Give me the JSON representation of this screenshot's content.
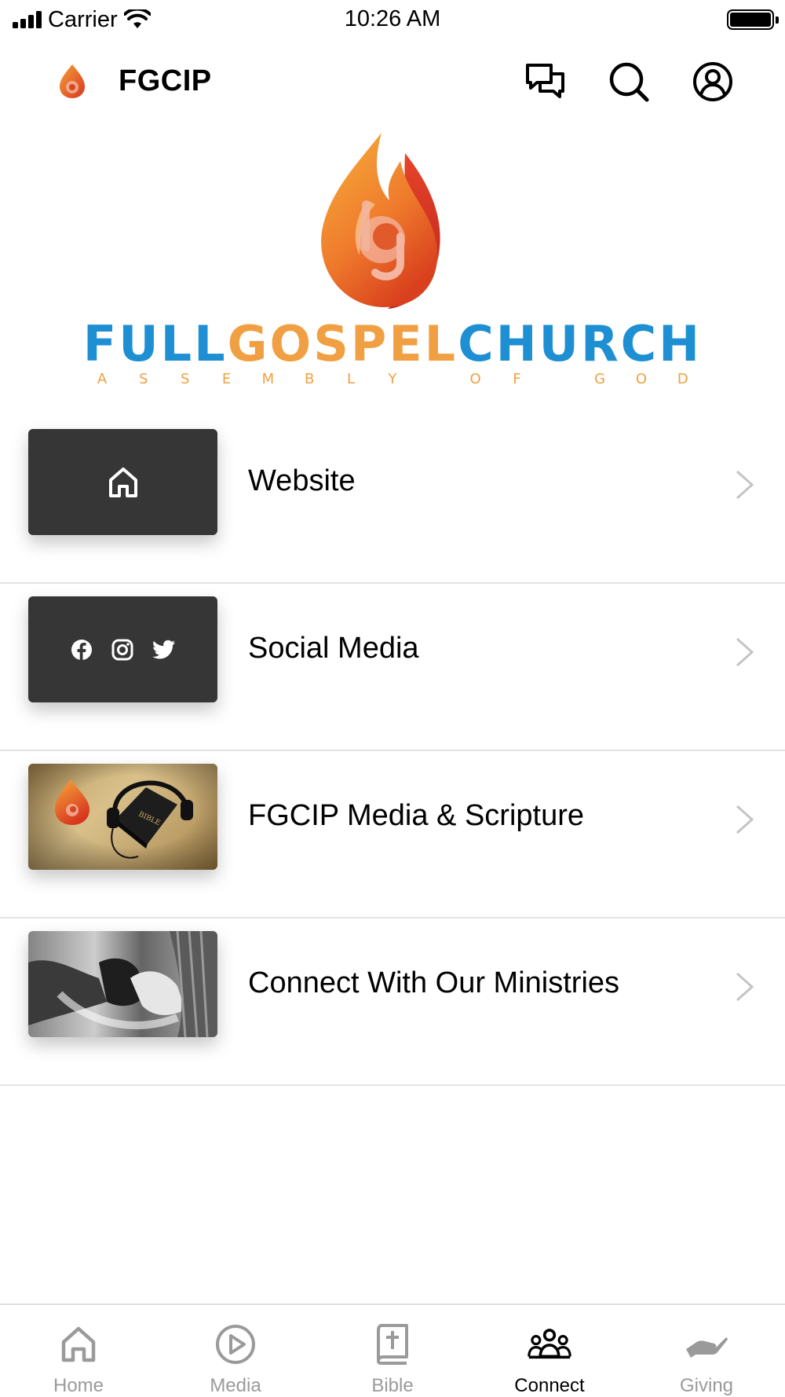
{
  "status_bar": {
    "carrier": "Carrier",
    "time": "10:26 AM"
  },
  "header": {
    "title": "FGCIP",
    "icons": [
      "chat-icon",
      "search-icon",
      "account-icon"
    ]
  },
  "hero": {
    "brand_full": "FULL",
    "brand_gospel": "GOSPEL",
    "brand_church": "CHURCH",
    "brand_subtitle_letters": [
      "A",
      "S",
      "S",
      "E",
      "M",
      "B",
      "L",
      "Y",
      "",
      "O",
      "F",
      "",
      "G",
      "O",
      "D"
    ],
    "colors": {
      "blue": "#1d8fd2",
      "orange": "#f0a042"
    }
  },
  "list": {
    "items": [
      {
        "label": "Website",
        "thumb": "home-icon"
      },
      {
        "label": "Social Media",
        "thumb": "social-icons"
      },
      {
        "label": "FGCIP Media & Scripture",
        "thumb": "bible-headphones-image"
      },
      {
        "label": "Connect With Our Ministries",
        "thumb": "holding-hands-image"
      }
    ]
  },
  "tabs": [
    {
      "label": "Home",
      "icon": "home-icon",
      "active": false
    },
    {
      "label": "Media",
      "icon": "play-circle-icon",
      "active": false
    },
    {
      "label": "Bible",
      "icon": "bible-icon",
      "active": false
    },
    {
      "label": "Connect",
      "icon": "group-icon",
      "active": true
    },
    {
      "label": "Giving",
      "icon": "giving-hand-icon",
      "active": false
    }
  ]
}
